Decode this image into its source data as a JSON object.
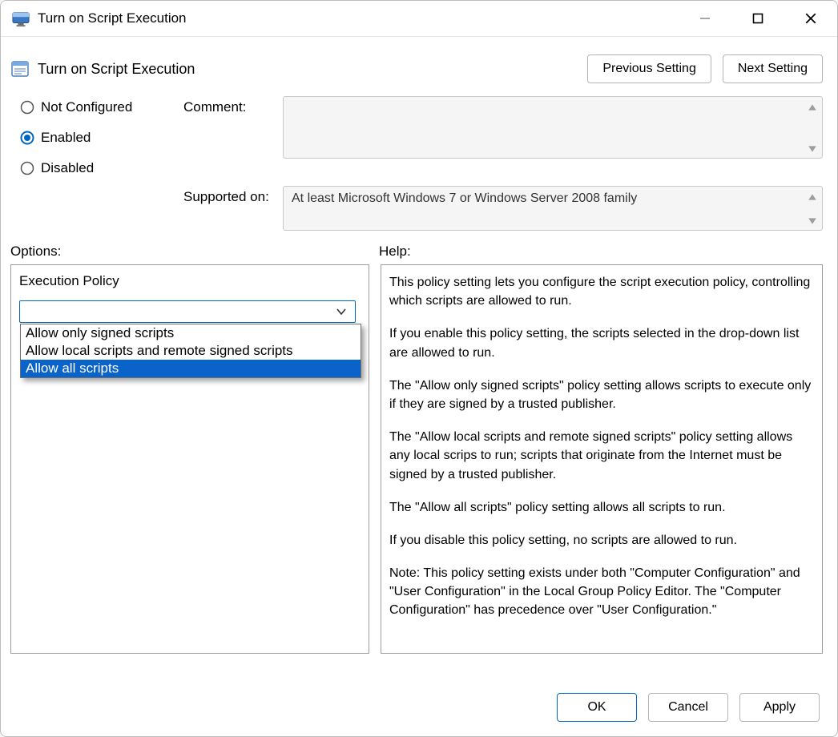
{
  "window": {
    "title": "Turn on Script Execution"
  },
  "header": {
    "policy_title": "Turn on Script Execution",
    "prev_label": "Previous Setting",
    "next_label": "Next Setting"
  },
  "state": {
    "not_configured_label": "Not Configured",
    "enabled_label": "Enabled",
    "disabled_label": "Disabled",
    "selected": "Enabled",
    "comment_label": "Comment:",
    "comment_value": "",
    "supported_label": "Supported on:",
    "supported_value": "At least Microsoft Windows 7 or Windows Server 2008 family"
  },
  "sections": {
    "options_label": "Options:",
    "help_label": "Help:"
  },
  "options": {
    "execution_policy_label": "Execution Policy",
    "combo_value": "",
    "dropdown": {
      "items": [
        "Allow only signed scripts",
        "Allow local scripts and remote signed scripts",
        "Allow all scripts"
      ],
      "highlighted_index": 2
    }
  },
  "help": {
    "p0": "This policy setting lets you configure the script execution policy, controlling which scripts are allowed to run.",
    "p1": "If you enable this policy setting, the scripts selected in the drop-down list are allowed to run.",
    "p2": "The \"Allow only signed scripts\" policy setting allows scripts to execute only if they are signed by a trusted publisher.",
    "p3": "The \"Allow local scripts and remote signed scripts\" policy setting allows any local scrips to run; scripts that originate from the Internet must be signed by a trusted publisher.",
    "p4": "The \"Allow all scripts\" policy setting allows all scripts to run.",
    "p5": "If you disable this policy setting, no scripts are allowed to run.",
    "p6": "Note: This policy setting exists under both \"Computer Configuration\" and \"User Configuration\" in the Local Group Policy Editor. The \"Computer Configuration\" has precedence over \"User Configuration.\""
  },
  "footer": {
    "ok_label": "OK",
    "cancel_label": "Cancel",
    "apply_label": "Apply"
  }
}
